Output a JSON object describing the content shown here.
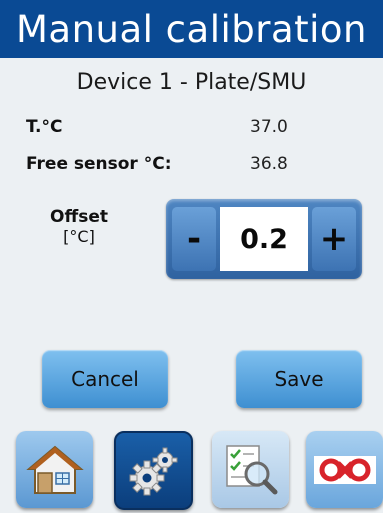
{
  "title": "Manual calibration",
  "device": "Device 1 - Plate/SMU",
  "readings": [
    {
      "label": "T.°C",
      "value": "37.0"
    },
    {
      "label": "Free sensor °C:",
      "value": "36.8"
    }
  ],
  "offset": {
    "label": "Offset",
    "unit": "[°C]",
    "value": "0.2",
    "minus": "-",
    "plus": "+"
  },
  "actions": {
    "cancel": "Cancel",
    "save": "Save"
  },
  "nav": [
    {
      "icon": "home-icon"
    },
    {
      "icon": "gears-icon"
    },
    {
      "icon": "magnifier-checklist-icon"
    },
    {
      "icon": "logo-icon"
    }
  ],
  "colors": {
    "title_bar": "#0a4a94",
    "button_gradient_top": "#7fc0ef",
    "button_gradient_bottom": "#3e8fd1",
    "stepper": "#3d73b3",
    "logo_red": "#d8232a"
  }
}
